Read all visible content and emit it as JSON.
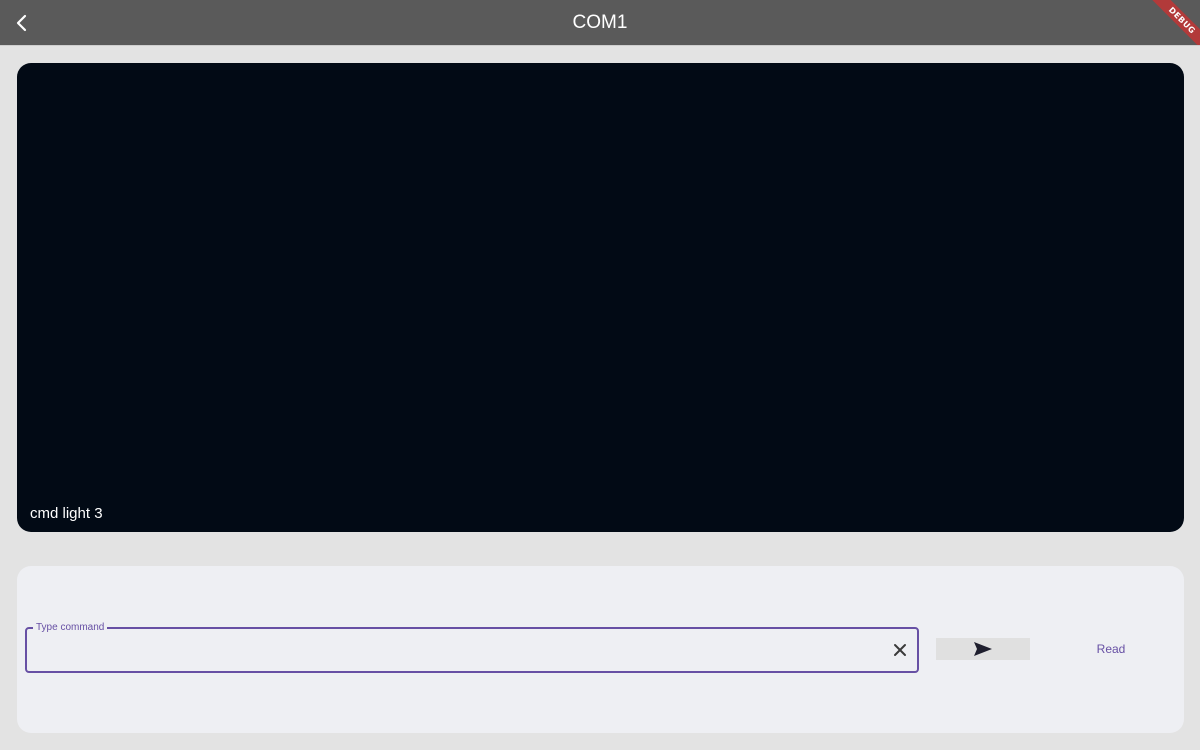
{
  "app_bar": {
    "title": "COM1",
    "back_icon": "chevron-left-icon",
    "debug_banner": "DEBUG"
  },
  "terminal": {
    "lines": [
      "cmd light 3"
    ]
  },
  "command_input": {
    "label": "Type command",
    "value": "",
    "clear_icon": "close-icon"
  },
  "send_button": {
    "icon": "send-icon"
  },
  "read_button": {
    "label": "Read"
  },
  "colors": {
    "accent": "#6750a4",
    "app_bar": "#5a5a5a",
    "terminal_bg": "#020a15"
  }
}
